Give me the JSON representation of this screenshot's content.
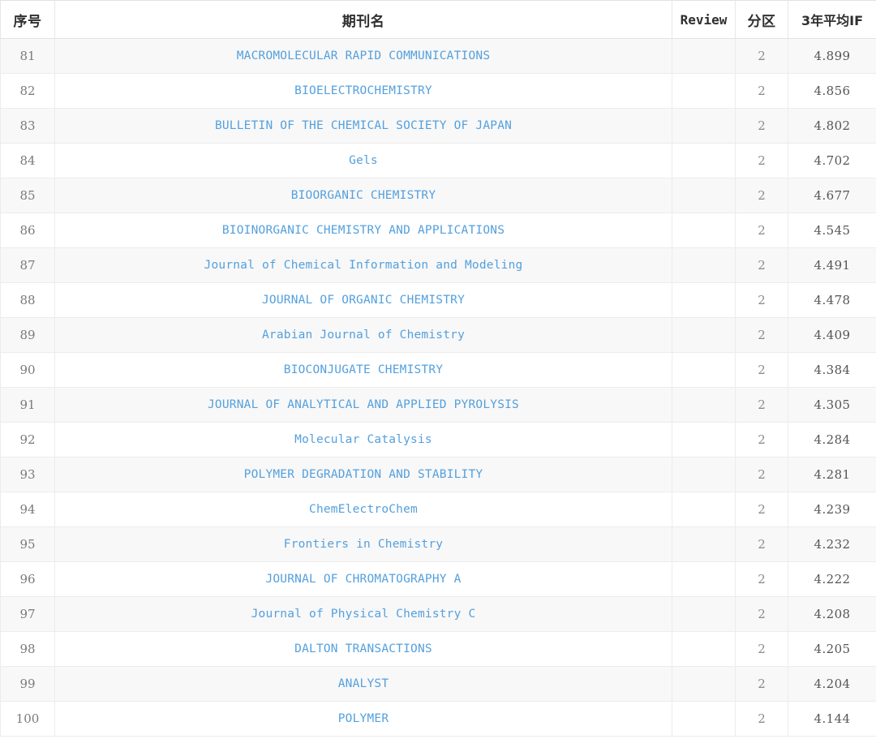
{
  "table": {
    "columns": [
      {
        "key": "rank",
        "label": "序号"
      },
      {
        "key": "name",
        "label": "期刊名"
      },
      {
        "key": "review",
        "label": "Review"
      },
      {
        "key": "zone",
        "label": "分区"
      },
      {
        "key": "if3",
        "label": "3年平均IF"
      }
    ],
    "colors": {
      "journal_name": "#54a0dd",
      "header_text": "#2f2f2f",
      "body_text": "#7a7a7a",
      "row_stripe": "#f8f8f8",
      "row_plain": "#ffffff",
      "border": "#ececec"
    },
    "rows": [
      {
        "rank": "81",
        "name": "MACROMOLECULAR RAPID COMMUNICATIONS",
        "review": "",
        "zone": "2",
        "if3": "4.899"
      },
      {
        "rank": "82",
        "name": "BIOELECTROCHEMISTRY",
        "review": "",
        "zone": "2",
        "if3": "4.856"
      },
      {
        "rank": "83",
        "name": "BULLETIN OF THE CHEMICAL SOCIETY OF JAPAN",
        "review": "",
        "zone": "2",
        "if3": "4.802"
      },
      {
        "rank": "84",
        "name": "Gels",
        "review": "",
        "zone": "2",
        "if3": "4.702"
      },
      {
        "rank": "85",
        "name": "BIOORGANIC CHEMISTRY",
        "review": "",
        "zone": "2",
        "if3": "4.677"
      },
      {
        "rank": "86",
        "name": "BIOINORGANIC CHEMISTRY AND APPLICATIONS",
        "review": "",
        "zone": "2",
        "if3": "4.545"
      },
      {
        "rank": "87",
        "name": "Journal of Chemical Information and Modeling",
        "review": "",
        "zone": "2",
        "if3": "4.491"
      },
      {
        "rank": "88",
        "name": "JOURNAL OF ORGANIC CHEMISTRY",
        "review": "",
        "zone": "2",
        "if3": "4.478"
      },
      {
        "rank": "89",
        "name": "Arabian Journal of Chemistry",
        "review": "",
        "zone": "2",
        "if3": "4.409"
      },
      {
        "rank": "90",
        "name": "BIOCONJUGATE CHEMISTRY",
        "review": "",
        "zone": "2",
        "if3": "4.384"
      },
      {
        "rank": "91",
        "name": "JOURNAL OF ANALYTICAL AND APPLIED PYROLYSIS",
        "review": "",
        "zone": "2",
        "if3": "4.305"
      },
      {
        "rank": "92",
        "name": "Molecular Catalysis",
        "review": "",
        "zone": "2",
        "if3": "4.284"
      },
      {
        "rank": "93",
        "name": "POLYMER DEGRADATION AND STABILITY",
        "review": "",
        "zone": "2",
        "if3": "4.281"
      },
      {
        "rank": "94",
        "name": "ChemElectroChem",
        "review": "",
        "zone": "2",
        "if3": "4.239"
      },
      {
        "rank": "95",
        "name": "Frontiers in Chemistry",
        "review": "",
        "zone": "2",
        "if3": "4.232"
      },
      {
        "rank": "96",
        "name": "JOURNAL OF CHROMATOGRAPHY A",
        "review": "",
        "zone": "2",
        "if3": "4.222"
      },
      {
        "rank": "97",
        "name": "Journal of Physical Chemistry C",
        "review": "",
        "zone": "2",
        "if3": "4.208"
      },
      {
        "rank": "98",
        "name": "DALTON TRANSACTIONS",
        "review": "",
        "zone": "2",
        "if3": "4.205"
      },
      {
        "rank": "99",
        "name": "ANALYST",
        "review": "",
        "zone": "2",
        "if3": "4.204"
      },
      {
        "rank": "100",
        "name": "POLYMER",
        "review": "",
        "zone": "2",
        "if3": "4.144"
      }
    ]
  }
}
